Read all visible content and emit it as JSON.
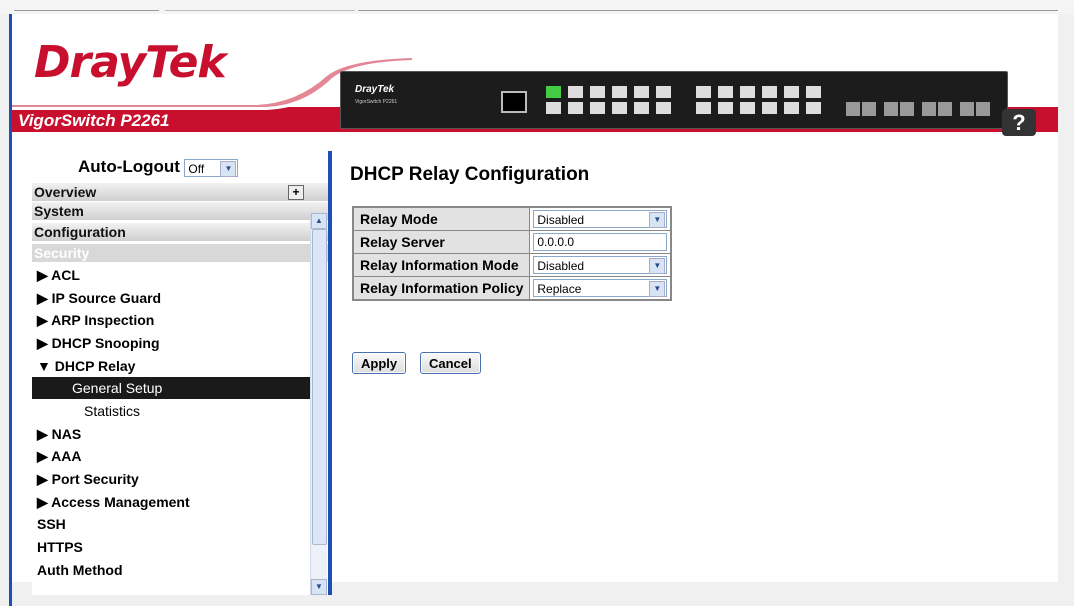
{
  "header": {
    "brand": "DrayTek",
    "model": "VigorSwitch P2261",
    "device_brand": "DrayTek",
    "device_model": "VigorSwitch P2261",
    "help_label": "?"
  },
  "sidebar": {
    "autologout_label": "Auto-Logout",
    "autologout_value": "Off",
    "sections": [
      {
        "label": "Overview"
      },
      {
        "label": "System"
      },
      {
        "label": "Configuration"
      },
      {
        "label": "Security"
      }
    ],
    "items": [
      {
        "label": "▶ ACL"
      },
      {
        "label": "▶ IP Source Guard"
      },
      {
        "label": "▶ ARP Inspection"
      },
      {
        "label": "▶ DHCP Snooping"
      },
      {
        "label": "▼ DHCP Relay"
      },
      {
        "label": "General Setup"
      },
      {
        "label": "Statistics"
      },
      {
        "label": "▶ NAS"
      },
      {
        "label": "▶ AAA"
      },
      {
        "label": "▶ Port Security"
      },
      {
        "label": "▶ Access Management"
      },
      {
        "label": "SSH"
      },
      {
        "label": "HTTPS"
      },
      {
        "label": "Auth Method"
      }
    ]
  },
  "main": {
    "title": "DHCP Relay Configuration",
    "rows": [
      {
        "label": "Relay Mode",
        "value": "Disabled",
        "type": "select"
      },
      {
        "label": "Relay Server",
        "value": "0.0.0.0",
        "type": "input"
      },
      {
        "label": "Relay Information Mode",
        "value": "Disabled",
        "type": "select"
      },
      {
        "label": "Relay Information Policy",
        "value": "Replace",
        "type": "select"
      }
    ],
    "apply_label": "Apply",
    "cancel_label": "Cancel"
  },
  "colors": {
    "brand_red": "#c8102e",
    "accent_blue": "#1e4fb4"
  }
}
